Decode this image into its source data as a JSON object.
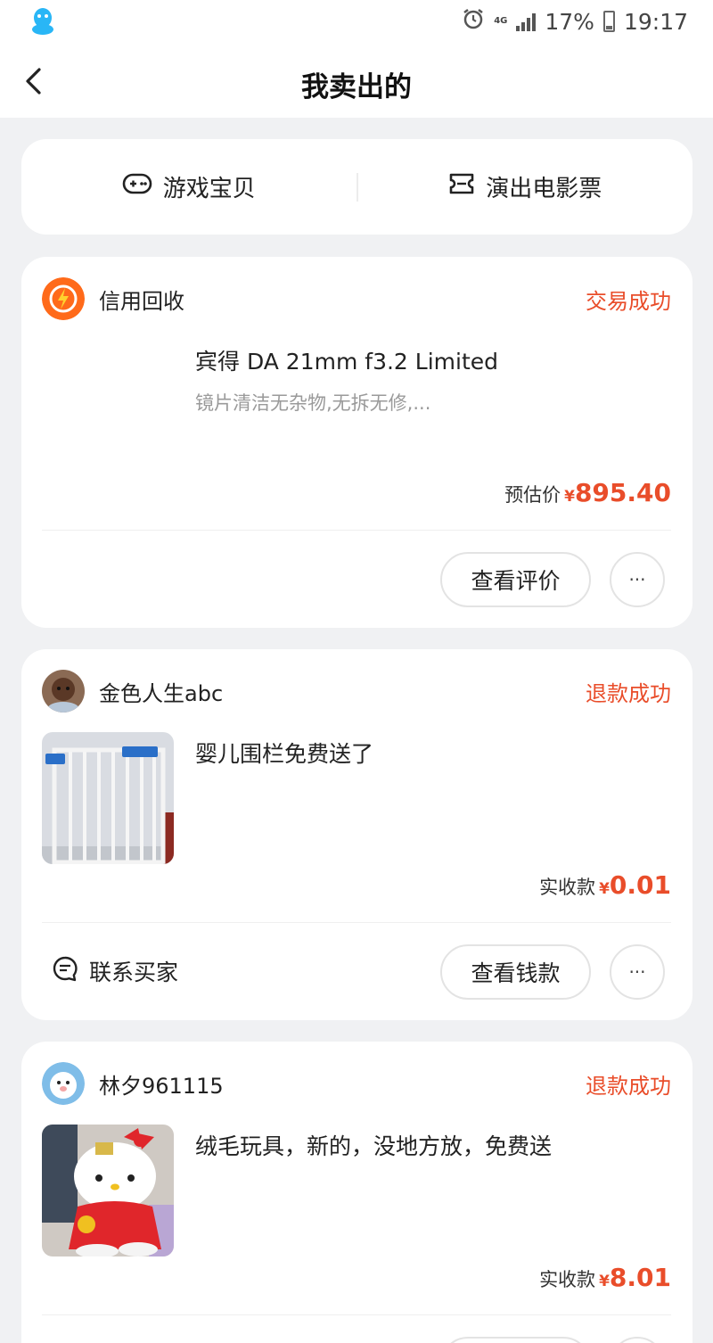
{
  "status_bar": {
    "network": "4G",
    "battery": "17%",
    "time": "19:17"
  },
  "header": {
    "title": "我卖出的"
  },
  "categories": [
    {
      "label": "游戏宝贝",
      "icon": "gamepad-icon"
    },
    {
      "label": "演出电影票",
      "icon": "ticket-icon"
    }
  ],
  "orders": [
    {
      "seller": "信用回收",
      "status": "交易成功",
      "title": "宾得 DA 21mm f3.2 Limited",
      "desc": "镜片清洁无杂物,无拆无修,...",
      "price_label": "预估价",
      "currency": "¥",
      "price": "895.40",
      "action": "查看评价",
      "more": "···"
    },
    {
      "seller": "金色人生abc",
      "status": "退款成功",
      "title": "婴儿围栏免费送了",
      "price_label": "实收款",
      "currency": "¥",
      "price": "0.01",
      "contact": "联系买家",
      "action": "查看钱款",
      "more": "···"
    },
    {
      "seller": "林夕961115",
      "status": "退款成功",
      "title": "绒毛玩具，新的，没地方放，免费送",
      "price_label": "实收款",
      "currency": "¥",
      "price": "8.01"
    }
  ],
  "colors": {
    "accent": "#e94d2a",
    "background": "#f0f1f3"
  }
}
